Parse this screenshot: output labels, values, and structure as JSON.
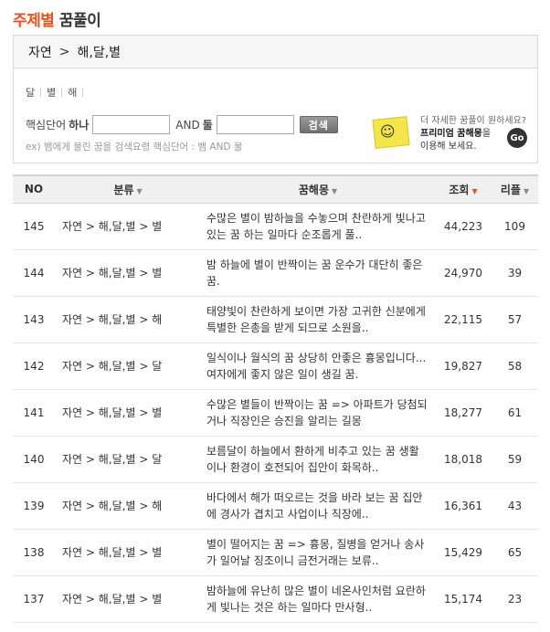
{
  "title": {
    "accent": "주제별",
    "rest": "꿈풀이"
  },
  "breadcrumb": {
    "level1": "자연",
    "separator": ">",
    "level2": "해,달,별"
  },
  "subcategories": [
    "달",
    "별",
    "해"
  ],
  "search": {
    "keyword_label": "핵심단어",
    "one_label": "하나",
    "and_label": "AND",
    "two_label": "둘",
    "button_label": "검색",
    "example": "ex) 뱀에게 물린 꿈을 검색요령 핵심단어 : 뱀 AND 물",
    "input1_value": "",
    "input2_value": ""
  },
  "promo": {
    "line1": "더 자세한 꿈풀이 원하세요?",
    "line2_bold": "프리미엄 꿈해몽",
    "line2_rest": "을",
    "line3": "이용해 보세요.",
    "go_label": "Go",
    "face": "☺"
  },
  "table": {
    "headers": {
      "no": "NO",
      "category": "분류",
      "dream": "꿈해몽",
      "views": "조회",
      "replies": "리플"
    },
    "rows": [
      {
        "no": "145",
        "category": "자연 > 해,달,별 > 별",
        "dream": "수많은 별이 밤하늘을 수놓으며 찬란하게 빛나고 있는 꿈 하는 일마다 순조롭게 풀..",
        "views": "44,223",
        "replies": "109"
      },
      {
        "no": "144",
        "category": "자연 > 해,달,별 > 별",
        "dream": "밤 하늘에 별이 반짝이는 꿈 운수가 대단히 좋은 꿈.",
        "views": "24,970",
        "replies": "39"
      },
      {
        "no": "143",
        "category": "자연 > 해,달,별 > 해",
        "dream": "태양빛이 찬란하게 보이면 가장 고귀한 신분에게 특별한 은총을 받게 되므로 소원을..",
        "views": "22,115",
        "replies": "57"
      },
      {
        "no": "142",
        "category": "자연 > 해,달,별 > 달",
        "dream": "일식이나 월식의 꿈 상당히 안좋은 흉몽입니다...여자에게 좋지 않은 일이 생길 꿈.",
        "views": "19,827",
        "replies": "58"
      },
      {
        "no": "141",
        "category": "자연 > 해,달,별 > 별",
        "dream": "수많은 별들이 반짝이는 꿈 => 아파트가 당첨되거나 직장인은 승진을 알리는 길몽",
        "views": "18,277",
        "replies": "61"
      },
      {
        "no": "140",
        "category": "자연 > 해,달,별 > 달",
        "dream": "보름달이 하늘에서 환하게 비추고 있는 꿈 생활이나 환경이 호전되어 집안이 화목하..",
        "views": "18,018",
        "replies": "59"
      },
      {
        "no": "139",
        "category": "자연 > 해,달,별 > 해",
        "dream": "바다에서 해가 떠오르는 것을 바라 보는 꿈 집안에 경사가 겹치고 사업이나 직장에..",
        "views": "16,361",
        "replies": "43"
      },
      {
        "no": "138",
        "category": "자연 > 해,달,별 > 별",
        "dream": "별이 떨어지는 꿈 => 흉몽, 질병을 얻거나 송사가 일어날 징조이니 금전거래는 보류..",
        "views": "15,429",
        "replies": "65"
      },
      {
        "no": "137",
        "category": "자연 > 해,달,별 > 별",
        "dream": "밤하늘에 유난히 많은 별이 네온사인처럼 요란하게 빛나는 것은 하는 일마다 만사형..",
        "views": "15,174",
        "replies": "23"
      }
    ]
  },
  "colors": {
    "accent": "#e8531d",
    "header_bg": "#f0f0f0"
  }
}
